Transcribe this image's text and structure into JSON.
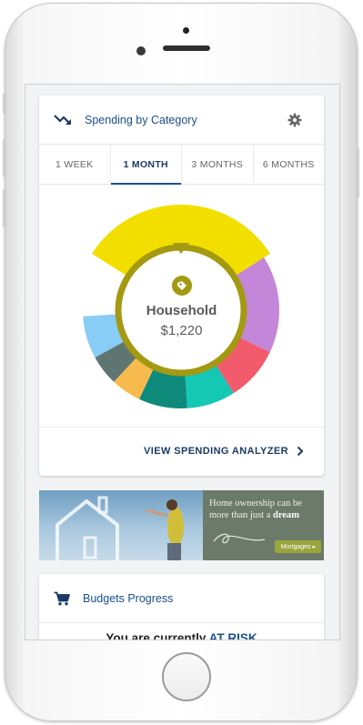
{
  "spending": {
    "title": "Spending by Category",
    "tabs": [
      "1 WEEK",
      "1 MONTH",
      "3 MONTHS",
      "6 MONTHS"
    ],
    "active_tab": "1 MONTH",
    "selected_category": "Household",
    "selected_amount": "$1,220",
    "link_label": "VIEW SPENDING ANALYZER",
    "segments": [
      {
        "name": "Household",
        "color": "#f2df00",
        "share": 0.32
      },
      {
        "name": "purple",
        "color": "#c486d8",
        "share": 0.16
      },
      {
        "name": "red",
        "color": "#f25b6b",
        "share": 0.09
      },
      {
        "name": "teal",
        "color": "#14c8b4",
        "share": 0.08
      },
      {
        "name": "dark-teal",
        "color": "#0e8a7a",
        "share": 0.08
      },
      {
        "name": "orange",
        "color": "#f7bb4d",
        "share": 0.05
      },
      {
        "name": "slate",
        "color": "#5f7572",
        "share": 0.05
      },
      {
        "name": "light-blue",
        "color": "#88cdf5",
        "share": 0.07
      }
    ]
  },
  "banner": {
    "line1": "Home ownership can be more than just a ",
    "emph": "dream",
    "button": "Mortgages ▸"
  },
  "budgets": {
    "title": "Budgets Progress",
    "status_prefix": "You are currently ",
    "status_value": "AT RISK"
  },
  "colors": {
    "accent": "#1a4f8b",
    "household": "#f2df00",
    "ring": "#a39a12"
  },
  "icons": {
    "trend": "trending-down-icon",
    "settings": "gear-icon",
    "tag": "tag-icon",
    "cart": "cart-icon",
    "chevron": "chevron-right-icon"
  }
}
